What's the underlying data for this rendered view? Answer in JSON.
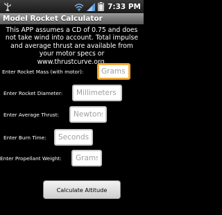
{
  "status_bar": {
    "time": "7:33 PM",
    "icons": [
      "usb-icon",
      "wifi-icon",
      "signal-icon",
      "battery-icon"
    ]
  },
  "app": {
    "title": "Model Rocket Calculator"
  },
  "intro_text": "This APP assumes a CD of 0.75 and does not take wind into account.  Total impulse and average thrust are available from your motor specs or www.thrustcurve.org.",
  "form": {
    "fields": [
      {
        "label": "Enter Rocket Mass (with motor):",
        "placeholder": "Grams"
      },
      {
        "label": "Enter Rocket Diameter:",
        "placeholder": "Millimeters"
      },
      {
        "label": "Enter Average Thrust:",
        "placeholder": "Newtons"
      },
      {
        "label": "Enter Burn Time:",
        "placeholder": "Seconds"
      },
      {
        "label": "Enter Propellant Weight:",
        "placeholder": "Grams"
      }
    ],
    "submit_label": "Calculate Altitude"
  },
  "colors": {
    "focus_accent": "#f2a52b",
    "title_bar": "#7a7a7a"
  }
}
